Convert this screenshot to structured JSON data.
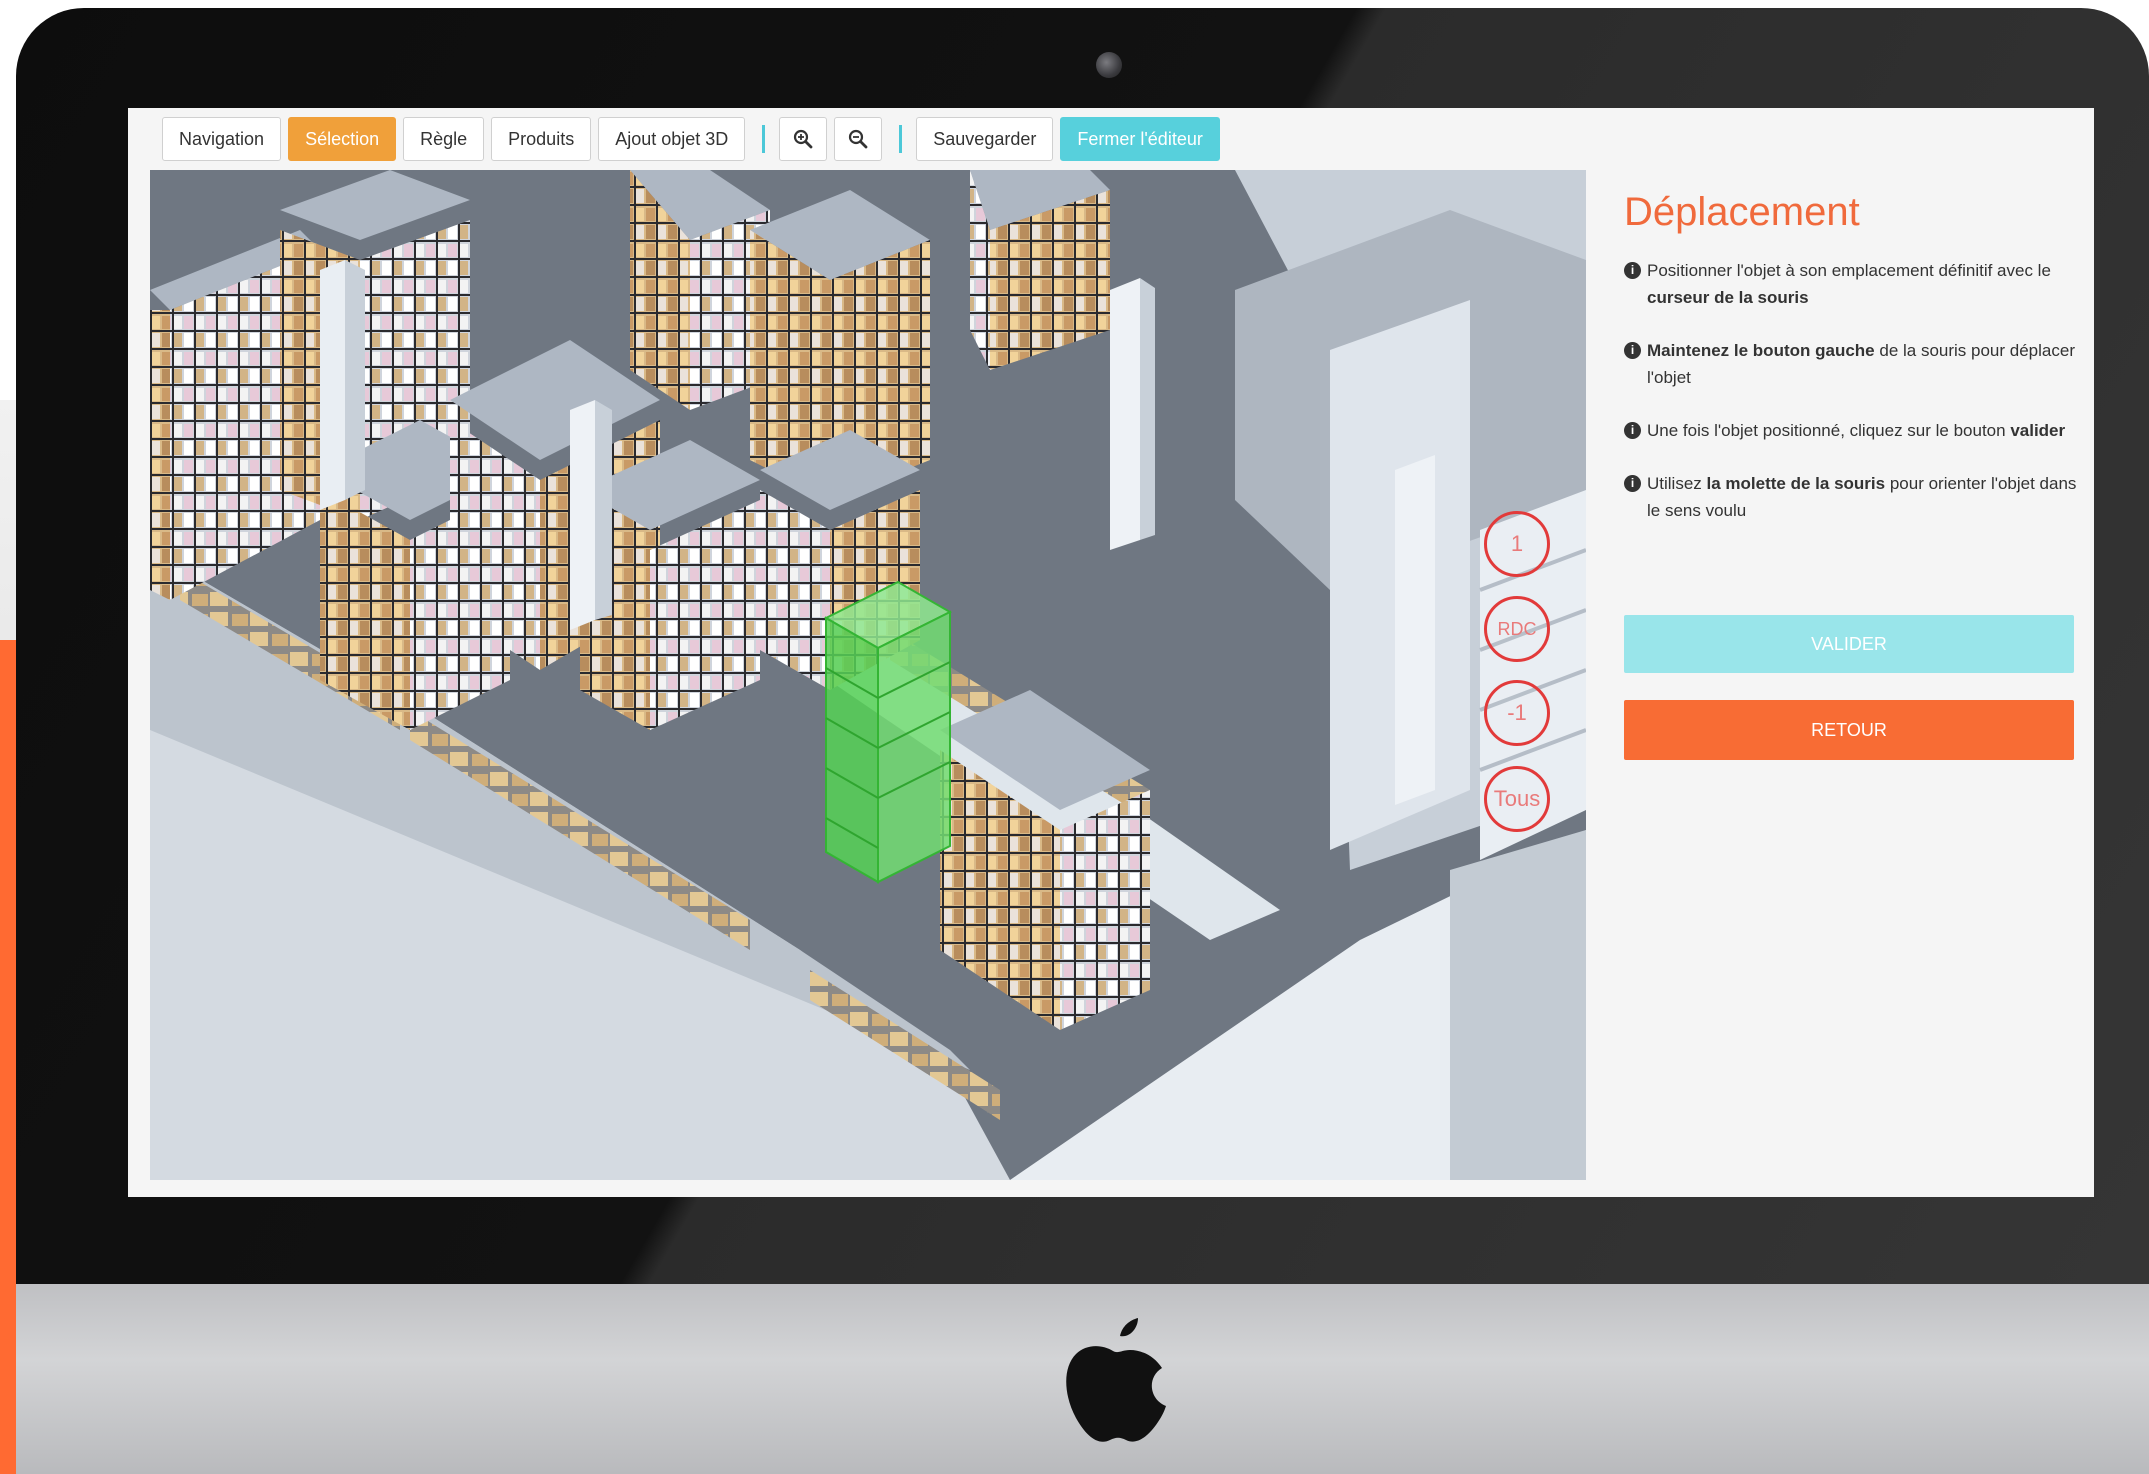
{
  "toolbar": {
    "navigation": "Navigation",
    "selection": "Sélection",
    "regle": "Règle",
    "produits": "Produits",
    "ajout_objet": "Ajout objet 3D",
    "zoom_in_icon": "zoom-in-icon",
    "zoom_out_icon": "zoom-out-icon",
    "sauvegarder": "Sauvegarder",
    "fermer": "Fermer l'éditeur"
  },
  "panel": {
    "title": "Déplacement",
    "tips": [
      {
        "pre": "Positionner l'objet à son emplacement définitif avec le",
        "bold": "curseur de la souris",
        "post": ""
      },
      {
        "pre": "",
        "bold": "Maintenez le bouton gauche",
        "post": "de la souris pour déplacer l'objet"
      },
      {
        "pre": "Une fois l'objet positionné, cliquez sur le bouton",
        "bold": "valider",
        "post": ""
      },
      {
        "pre": "Utilisez",
        "bold": "la molette de la souris",
        "post": "pour orienter l'objet dans le sens voulu"
      }
    ],
    "valider": "VALIDER",
    "retour": "RETOUR"
  },
  "levels": [
    "1",
    "RDC",
    "-1",
    "Tous"
  ],
  "colors": {
    "accent_orange": "#f06a3c",
    "retour": "#f86c34",
    "valider": "#99e5ea",
    "selection_tab": "#f0a03a",
    "fermer_tab": "#57d0dc",
    "level_ring": "#e23a3a",
    "selected_object": "#4fd14f"
  }
}
